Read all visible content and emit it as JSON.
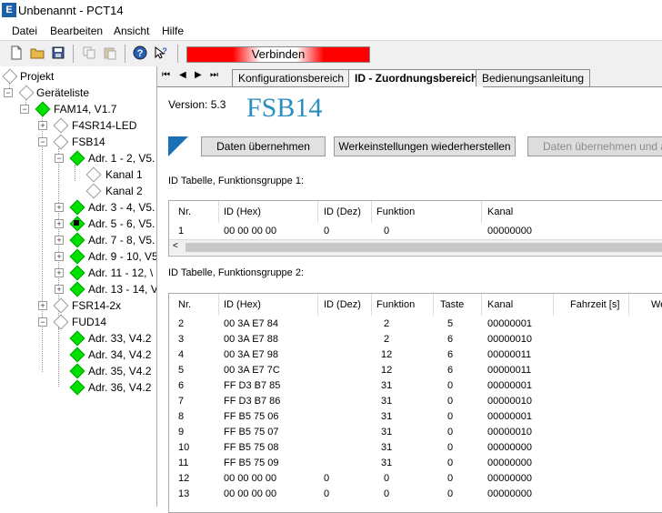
{
  "window": {
    "title": "Unbenannt - PCT14",
    "icon": "app-icon"
  },
  "menu": [
    "Datei",
    "Bearbeiten",
    "Ansicht",
    "Hilfe"
  ],
  "toolbar": {
    "icons": [
      "new-file-icon",
      "open-folder-icon",
      "save-icon",
      "copy-icon",
      "paste-icon",
      "help-icon",
      "context-help-icon"
    ],
    "connect_label": "Verbinden"
  },
  "tree": {
    "project": "Projekt",
    "devices_root": "Geräteliste",
    "fam": "FAM14, V1.7",
    "f4sr": "F4SR14-LED",
    "fsb": "FSB14",
    "adr12": "Adr. 1 - 2, V5.",
    "kanal1": "Kanal 1",
    "kanal2": "Kanal 2",
    "adr34": "Adr. 3 - 4, V5.",
    "adr56": "Adr. 5 - 6, V5.",
    "adr78": "Adr. 7 - 8, V5.",
    "adr910": "Adr. 9 - 10, V5",
    "adr1112": "Adr. 11 - 12, \\",
    "adr1314": "Adr. 13 - 14, V",
    "fsr": "FSR14-2x",
    "fud": "FUD14",
    "adr33": "Adr. 33, V4.2",
    "adr34b": "Adr. 34, V4.2",
    "adr35": "Adr. 35, V4.2",
    "adr36": "Adr. 36, V4.2"
  },
  "tabs": [
    "Konfigurationsbereich",
    "ID - Zuordnungsbereich",
    "Bedienungsanleitung"
  ],
  "nav": [
    "⏮",
    "◀",
    "▶",
    "⏭"
  ],
  "content": {
    "version": "Version: 5.3",
    "device": "FSB14",
    "btn_apply": "Daten übernehmen",
    "btn_reset": "Werkeinstellungen wiederherstellen",
    "btn_apply_more": "Daten übernehmen und auf",
    "table1_title": "ID Tabelle, Funktionsgruppe 1:",
    "table2_title": "ID Tabelle, Funktionsgruppe 2:"
  },
  "table1": {
    "headers": [
      "Nr.",
      "ID (Hex)",
      "ID (Dez)",
      "Funktion",
      "Kanal"
    ],
    "rows": [
      [
        "1",
        "00 00 00 00",
        "0",
        "0",
        "00000000"
      ]
    ]
  },
  "table2": {
    "headers": [
      "Nr.",
      "ID (Hex)",
      "ID (Dez)",
      "Funktion",
      "Taste",
      "Kanal",
      "Fahrzeit [s]",
      "We"
    ],
    "rows": [
      [
        "2",
        "00 3A E7 84",
        "",
        "2",
        "5",
        "00000001"
      ],
      [
        "3",
        "00 3A E7 88",
        "",
        "2",
        "6",
        "00000010"
      ],
      [
        "4",
        "00 3A E7 98",
        "",
        "12",
        "6",
        "00000011"
      ],
      [
        "5",
        "00 3A E7 7C",
        "",
        "12",
        "6",
        "00000011"
      ],
      [
        "6",
        "FF D3 B7 85",
        "",
        "31",
        "0",
        "00000001"
      ],
      [
        "7",
        "FF D3 B7 86",
        "",
        "31",
        "0",
        "00000010"
      ],
      [
        "8",
        "FF B5 75 06",
        "",
        "31",
        "0",
        "00000001"
      ],
      [
        "9",
        "FF B5 75 07",
        "",
        "31",
        "0",
        "00000010"
      ],
      [
        "10",
        "FF B5 75 08",
        "",
        "31",
        "0",
        "00000000"
      ],
      [
        "11",
        "FF B5 75 09",
        "",
        "31",
        "0",
        "00000000"
      ],
      [
        "12",
        "00 00 00 00",
        "0",
        "0",
        "0",
        "00000000"
      ],
      [
        "13",
        "00 00 00 00",
        "0",
        "0",
        "0",
        "00000000"
      ]
    ]
  },
  "colors": {
    "green": "#00e000",
    "connect": "#ff0000",
    "accent": "#1b6fb5",
    "title": "#2a8fbf"
  }
}
